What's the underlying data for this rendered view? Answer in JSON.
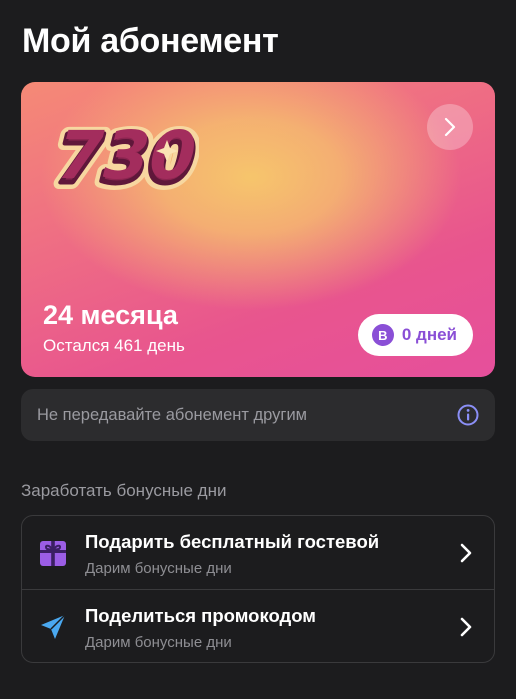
{
  "page": {
    "title": "Мой абонемент"
  },
  "card": {
    "logo_text": "730",
    "period": "24 месяца",
    "remaining": "Остался 461 день",
    "bonus_badge": "В",
    "bonus_days": "0 дней",
    "next_icon": "chevron-right-icon",
    "colors": {
      "gradient_warm": "#f6c56c",
      "gradient_pink": "#e64f9c",
      "accent_purple": "#8a4fd6"
    }
  },
  "notice": {
    "text": "Не передавайте абонемент другим",
    "icon": "info-icon",
    "icon_color": "#8b8ff6"
  },
  "bonus_section": {
    "label": "Заработать бонусные дни",
    "items": [
      {
        "title": "Подарить бесплатный гостевой",
        "subtitle": "Дарим бонусные дни",
        "icon": "gift-icon",
        "icon_color": "#9b5de5"
      },
      {
        "title": "Поделиться промокодом",
        "subtitle": "Дарим бонусные дни",
        "icon": "paper-plane-icon",
        "icon_color": "#4aa8f0"
      }
    ]
  }
}
